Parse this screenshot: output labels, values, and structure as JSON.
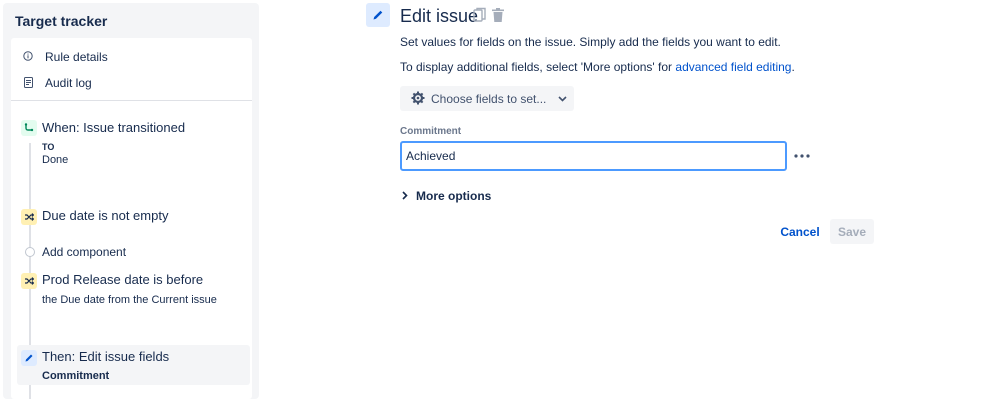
{
  "sidebar": {
    "title": "Target tracker",
    "nav": [
      {
        "label": "Rule details",
        "icon": "info-icon"
      },
      {
        "label": "Audit log",
        "icon": "document-icon"
      }
    ],
    "flow": {
      "trigger": {
        "title": "When: Issue transitioned",
        "to_label": "TO",
        "to_value": "Done",
        "icon": "transition-icon"
      },
      "condition1": {
        "title": "Due date is not empty",
        "icon": "shuffle-icon"
      },
      "add_component": "Add component",
      "condition2": {
        "title": "Prod Release date is before",
        "subtitle": "the Due date from the Current issue",
        "icon": "shuffle-icon"
      },
      "action": {
        "title": "Then: Edit issue fields",
        "subtitle": "Commitment",
        "icon": "pencil-icon"
      }
    }
  },
  "main": {
    "title": "Edit issue",
    "description": "Set values for fields on the issue. Simply add the fields you want to edit.",
    "additional_prefix": "To display additional fields, select 'More options' for ",
    "additional_link": "advanced field editing",
    "additional_suffix": ".",
    "choose_fields_label": "Choose fields to set...",
    "field": {
      "label": "Commitment",
      "value": "Achieved"
    },
    "more_options_label": "More options",
    "cancel_label": "Cancel",
    "save_label": "Save"
  },
  "colors": {
    "accent": "#0052cc",
    "focus_border": "#4c9aff",
    "panel_bg": "#f4f5f7"
  }
}
